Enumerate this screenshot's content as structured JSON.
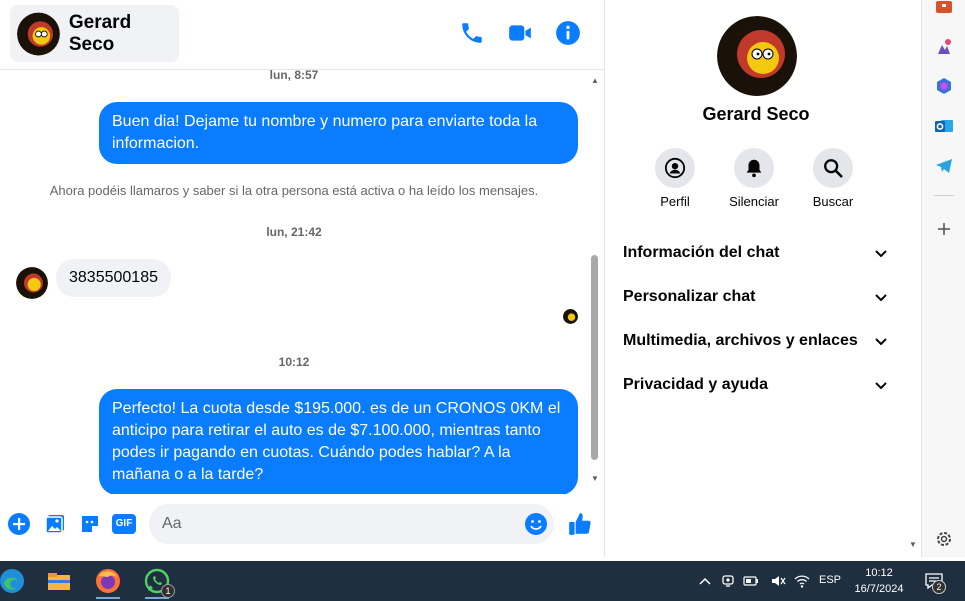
{
  "contact": {
    "name": "Gerard Seco"
  },
  "colors": {
    "accent": "#0a7cff",
    "panel_gray": "#e4e6eb",
    "taskbar": "#1f2f3f"
  },
  "header": {
    "icons": [
      "phone-icon",
      "video-camera-icon",
      "info-icon"
    ]
  },
  "messages": {
    "timestamp_1": "lun, 8:57",
    "outgoing_1": "Buen dia! Dejame tu nombre y  numero para enviarte toda la informacion.",
    "system_notice": "Ahora podéis llamaros y saber si la otra persona está activa o ha leído los mensajes.",
    "timestamp_2": "lun, 21:42",
    "incoming_1": "3835500185",
    "timestamp_3": "10:12",
    "outgoing_2": "Perfecto! La cuota desde $195.000. es de un CRONOS 0KM el anticipo para retirar el auto es de $7.100.000, mientras tanto podes ir pagando en cuotas. Cuándo podes hablar? A la mañana o a la tarde?"
  },
  "composer": {
    "placeholder": "Aa",
    "icons": [
      "plus-circle-icon",
      "photo-icon",
      "sticker-icon",
      "gif-icon",
      "emoji-icon",
      "thumbs-up-icon"
    ],
    "gif_label": "GIF"
  },
  "info_panel": {
    "name": "Gerard Seco",
    "actions": [
      {
        "label": "Perfil",
        "icon": "profile-icon"
      },
      {
        "label": "Silenciar",
        "icon": "bell-icon"
      },
      {
        "label": "Buscar",
        "icon": "search-icon"
      }
    ],
    "sections": [
      "Información del chat",
      "Personalizar chat",
      "Multimedia, archivos y enlaces",
      "Privacidad y ayuda"
    ]
  },
  "edge_sidebar": {
    "icons": [
      "shopping-bag-icon",
      "games-icon",
      "copilot-icon",
      "outlook-icon",
      "telegram-icon",
      "add-icon",
      "settings-icon"
    ]
  },
  "taskbar": {
    "apps": [
      "edge-icon",
      "file-explorer-icon",
      "firefox-icon",
      "whatsapp-icon"
    ],
    "whatsapp_badge": "1",
    "language": "ESP",
    "time": "10:12",
    "date": "16/7/2024",
    "notifications_count": "2"
  }
}
